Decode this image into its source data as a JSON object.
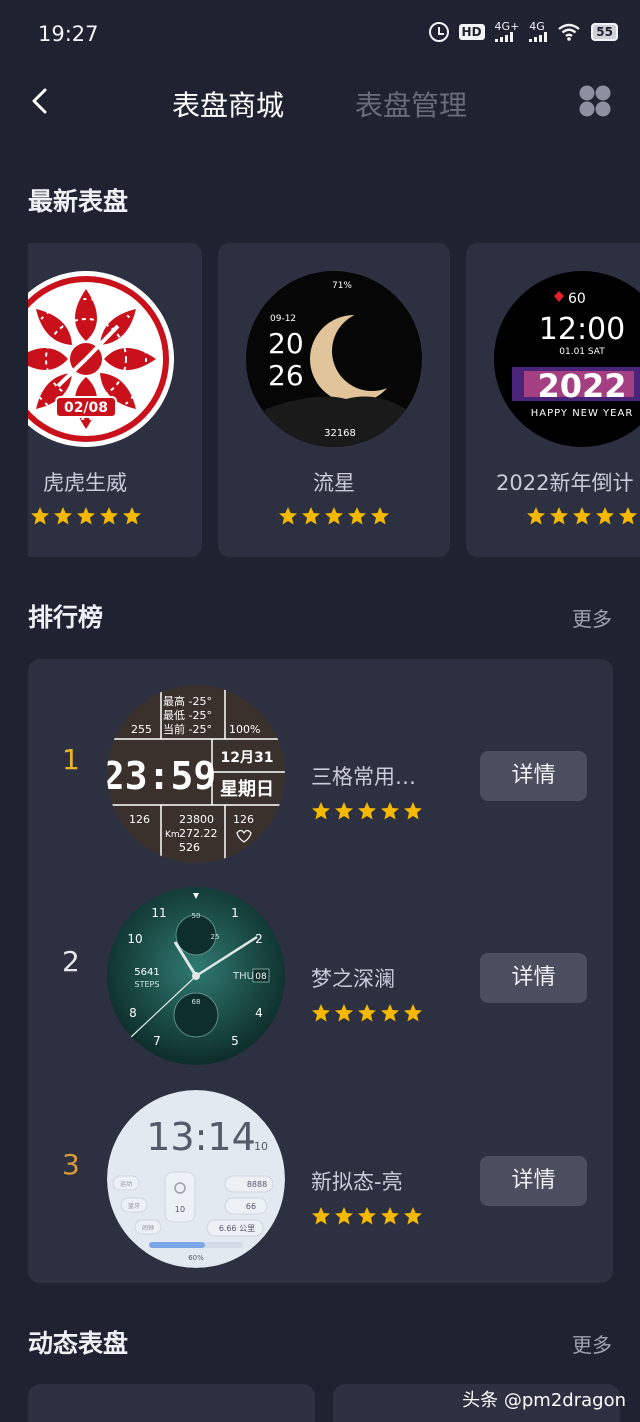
{
  "status_bar": {
    "time": "19:27",
    "hd_badge": "HD",
    "signal_1": "4G+",
    "signal_2": "4G",
    "battery": "55",
    "icons": [
      "alarm-icon",
      "hd-icon",
      "signal-icon",
      "wifi-icon",
      "battery-icon"
    ]
  },
  "nav": {
    "back_icon": "chevron-left-icon",
    "tab_store": "表盘商城",
    "tab_manage": "表盘管理",
    "grid_icon": "grid-icon",
    "active_tab": "表盘商城"
  },
  "latest": {
    "title": "最新表盘",
    "items": [
      {
        "name": "虎虎生威",
        "rating": 5,
        "face": {
          "date": "02/08"
        }
      },
      {
        "name": "流星",
        "rating": 5,
        "face": {
          "battery": "71%",
          "date": "09-12",
          "hour": "20",
          "minute": "26",
          "steps": "32168"
        }
      },
      {
        "name": "2022新年倒计",
        "rating": 5,
        "face": {
          "heart": "60",
          "time": "12:00",
          "date": "01.01 SAT",
          "year": "2022",
          "caption": "HAPPY NEW YEAR"
        }
      }
    ]
  },
  "ranking": {
    "title": "排行榜",
    "more": "更多",
    "detail_label": "详情",
    "items": [
      {
        "rank": "1",
        "name": "三格常用…",
        "rating": 5,
        "face": {
          "w1": "最高 -25°",
          "w2": "最低 -25°",
          "w3": "当前 -25°",
          "tl": "255",
          "batt": "100%",
          "time": "23:59",
          "date": "12月31",
          "weekday": "星期日",
          "bl": "126",
          "s1": "23800",
          "s2": "272.22",
          "s3": "526",
          "br": "126",
          "km": "Km"
        }
      },
      {
        "rank": "2",
        "name": "梦之深澜",
        "rating": 5,
        "face": {
          "n11": "11",
          "n1": "1",
          "n10": "10",
          "n2": "2",
          "n8": "8",
          "n4": "4",
          "n7": "7",
          "n5": "5",
          "steps": "5641",
          "steps_label": "STEPS",
          "day": "THU",
          "date": "08",
          "sub_top": "50",
          "sub_right": "25",
          "sub_bottom": "68"
        }
      },
      {
        "rank": "3",
        "name": "新拟态-亮",
        "rating": 5,
        "face": {
          "time": "13:14",
          "sec": "10",
          "a": "8888",
          "b": "66",
          "dist": "6.66 公里",
          "progress": "60%",
          "temp": "10",
          "lbl1": "运动",
          "lbl2": "蓝牙",
          "lbl3": "闹钟"
        }
      }
    ]
  },
  "dynamic": {
    "title": "动态表盘",
    "more": "更多"
  },
  "watermark": "头条 @pm2dragon",
  "colors": {
    "background": "#1f2230",
    "card": "#2c3041",
    "star": "#f5b800",
    "rank1": "#e6b428",
    "rank3": "#d99a3a",
    "button": "#4a4e5e"
  }
}
